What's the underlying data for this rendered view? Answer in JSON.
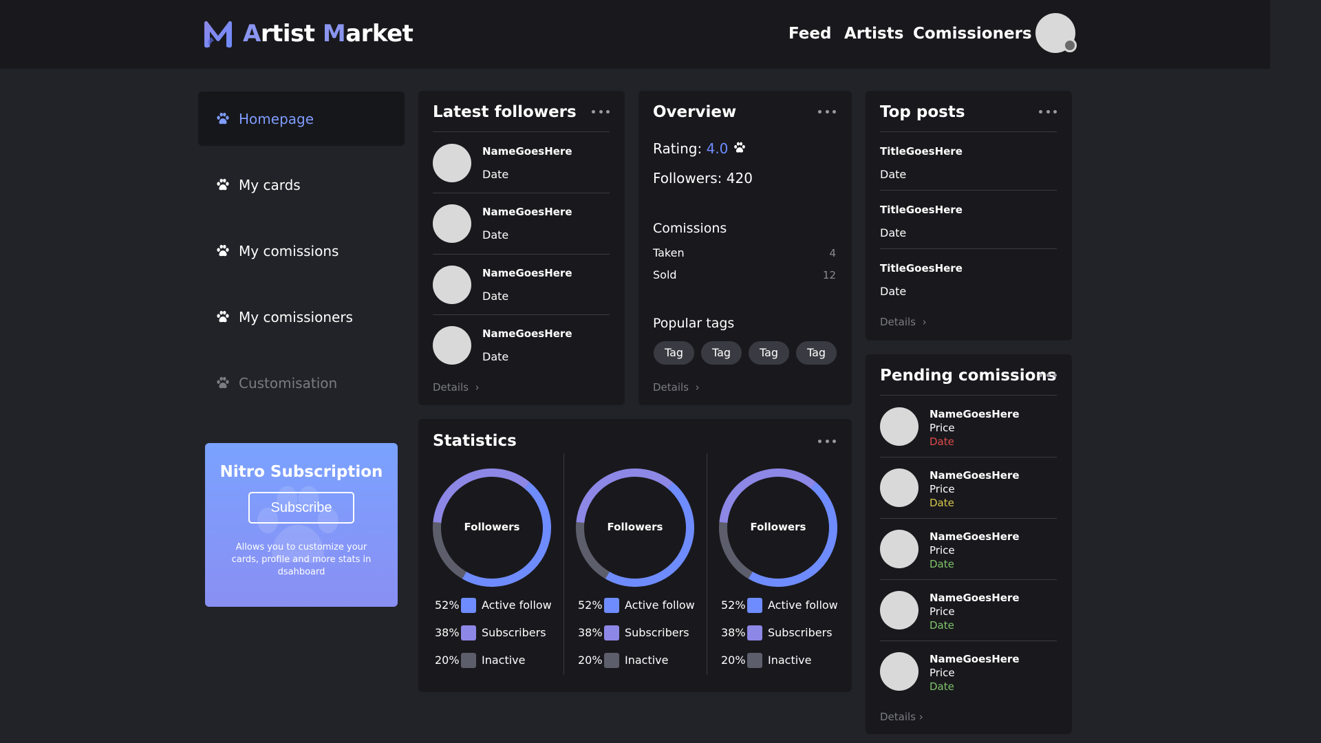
{
  "header": {
    "logo_prefix_acc": "A",
    "logo_word1_rest": "rtist ",
    "logo_prefix2_acc": "M",
    "logo_word2_rest": "arket",
    "nav": [
      {
        "label": "Feed"
      },
      {
        "label": "Artists"
      },
      {
        "label": "Comissioners"
      }
    ]
  },
  "sidebar": {
    "items": [
      {
        "label": "Homepage",
        "state": "active"
      },
      {
        "label": "My cards",
        "state": "normal"
      },
      {
        "label": "My comissions",
        "state": "normal"
      },
      {
        "label": "My comissioners",
        "state": "normal"
      },
      {
        "label": "Customisation",
        "state": "muted"
      }
    ],
    "nitro": {
      "title": "Nitro Subscription",
      "button": "Subscribe",
      "description": "Allows you to customize your cards, profile and more stats in dsahboard"
    }
  },
  "followers": {
    "title": "Latest followers",
    "items": [
      {
        "name": "NameGoesHere",
        "date": "Date"
      },
      {
        "name": "NameGoesHere",
        "date": "Date"
      },
      {
        "name": "NameGoesHere",
        "date": "Date"
      },
      {
        "name": "NameGoesHere",
        "date": "Date"
      }
    ],
    "details": "Details"
  },
  "overview": {
    "title": "Overview",
    "rating_label": "Rating:",
    "rating_value": "4.0",
    "followers_text": "Followers: 420",
    "comissions_heading": "Comissions",
    "taken_label": "Taken",
    "taken_value": "4",
    "sold_label": "Sold",
    "sold_value": "12",
    "tags_heading": "Popular tags",
    "tags": [
      "Tag",
      "Tag",
      "Tag",
      "Tag"
    ],
    "details": "Details"
  },
  "top_posts": {
    "title": "Top posts",
    "items": [
      {
        "title": "TitleGoesHere",
        "date": "Date"
      },
      {
        "title": "TitleGoesHere",
        "date": "Date"
      },
      {
        "title": "TitleGoesHere",
        "date": "Date"
      }
    ],
    "details": "Details"
  },
  "pending": {
    "title": "Pending comissions",
    "items": [
      {
        "name": "NameGoesHere",
        "price": "Price",
        "date": "Date",
        "date_color": "#e04a4a"
      },
      {
        "name": "NameGoesHere",
        "price": "Price",
        "date": "Date",
        "date_color": "#d7c64a"
      },
      {
        "name": "NameGoesHere",
        "price": "Price",
        "date": "Date",
        "date_color": "#7fc46a"
      },
      {
        "name": "NameGoesHere",
        "price": "Price",
        "date": "Date",
        "date_color": "#7fc46a"
      },
      {
        "name": "NameGoesHere",
        "price": "Price",
        "date": "Date",
        "date_color": "#7fc46a"
      }
    ],
    "details": "Details"
  },
  "statistics": {
    "title": "Statistics",
    "charts": [
      {
        "center_label": "Followers",
        "segments": [
          {
            "pct": "52%",
            "value": 52,
            "label": "Active follow",
            "color": "#6f8cff"
          },
          {
            "pct": "38%",
            "value": 38,
            "label": "Subscribers",
            "color": "#8d87e6"
          },
          {
            "pct": "20%",
            "value": 20,
            "label": "Inactive",
            "color": "#5d5e6b"
          }
        ]
      },
      {
        "center_label": "Followers",
        "segments": [
          {
            "pct": "52%",
            "value": 52,
            "label": "Active follow",
            "color": "#6f8cff"
          },
          {
            "pct": "38%",
            "value": 38,
            "label": "Subscribers",
            "color": "#8d87e6"
          },
          {
            "pct": "20%",
            "value": 20,
            "label": "Inactive",
            "color": "#5d5e6b"
          }
        ]
      },
      {
        "center_label": "Followers",
        "segments": [
          {
            "pct": "52%",
            "value": 52,
            "label": "Active follow",
            "color": "#6f8cff"
          },
          {
            "pct": "38%",
            "value": 38,
            "label": "Subscribers",
            "color": "#8d87e6"
          },
          {
            "pct": "20%",
            "value": 20,
            "label": "Inactive",
            "color": "#5d5e6b"
          }
        ]
      }
    ]
  },
  "colors": {
    "accent": "#6f8cff",
    "card_bg": "#19191d",
    "page_bg": "#222328"
  }
}
